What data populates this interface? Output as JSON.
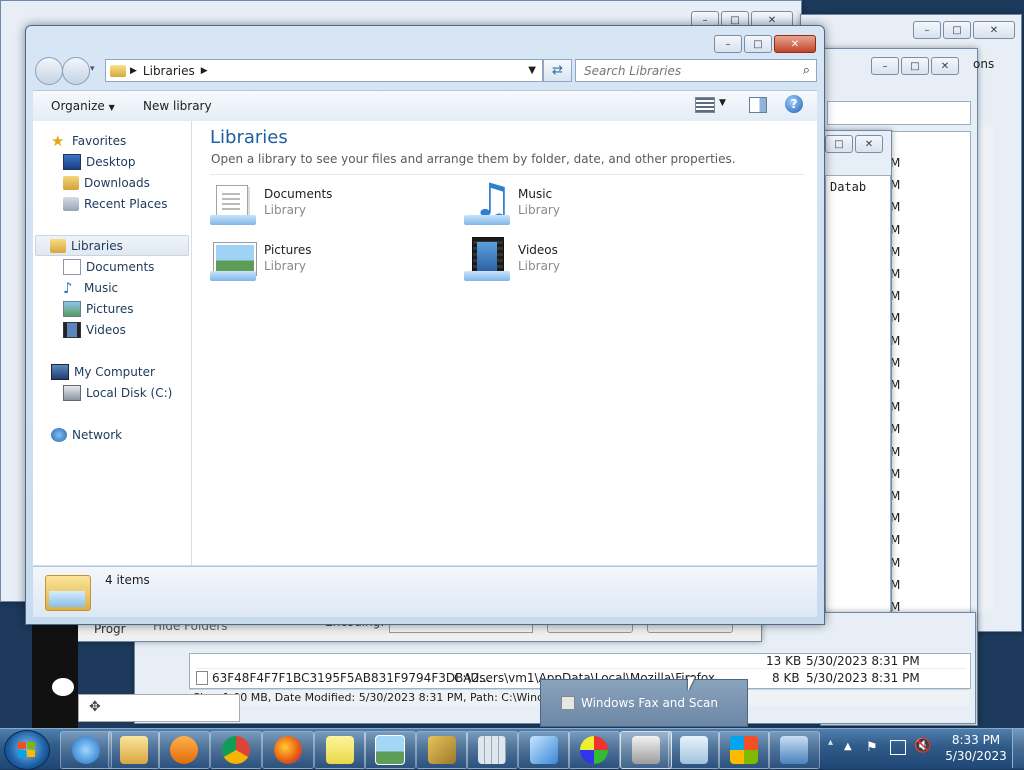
{
  "window": {
    "breadcrumb_root": "Libraries",
    "search_placeholder": "Search Libraries",
    "toolbar": {
      "organize": "Organize",
      "new_library": "New library"
    },
    "nav": {
      "favorites": "Favorites",
      "desktop": "Desktop",
      "downloads": "Downloads",
      "recent_places": "Recent Places",
      "libraries": "Libraries",
      "documents": "Documents",
      "music": "Music",
      "pictures": "Pictures",
      "videos": "Videos",
      "my_computer": "My Computer",
      "local_disk": "Local Disk (C:)",
      "network": "Network"
    },
    "content": {
      "title": "Libraries",
      "subtitle": "Open a library to see your files and arrange them by folder, date, and other properties.",
      "libraries": [
        {
          "name": "Documents",
          "type": "Library"
        },
        {
          "name": "Music",
          "type": "Library"
        },
        {
          "name": "Pictures",
          "type": "Library"
        },
        {
          "name": "Videos",
          "type": "Library"
        }
      ]
    },
    "details": {
      "count": "4 items"
    }
  },
  "background": {
    "hide_folders": "Hide Folders",
    "encoding": "Encoding:",
    "file_row_name": "63F48F4F7F1BC3195F5AB831F9794F3DBA2...",
    "file_row_path": "C:\\Users\\vm1\\AppData\\Local\\Mozilla\\Firefox...",
    "file_row_size": "8 KB",
    "file_row_date": "5/30/2023 8:31 PM",
    "file_row2_size": "13 KB",
    "file_row2_date": "5/30/2023 8:31 PM",
    "statusbar": "Size: 1.00 MB, Date Modified: 5/30/2023 8:31 PM, Path: C:\\Windows\\se",
    "progr": "Progr",
    "ons": "ons",
    "datab": "Datab",
    "m_letters": [
      "M",
      "M",
      "M",
      "M",
      "M",
      "M",
      "M",
      "M",
      "M",
      "M",
      "M",
      "M",
      "M",
      "M",
      "M",
      "M",
      "M",
      "M",
      "M",
      "M",
      "M",
      "M",
      "M",
      "M",
      "M"
    ]
  },
  "tooltip": {
    "label": "Windows Fax and Scan"
  },
  "tray": {
    "time": "8:33 PM",
    "date": "5/30/2023"
  },
  "colors": {
    "title_blue": "#1e5fa0",
    "taskbar": "#2f5986",
    "window_frame": "#c7dbef"
  }
}
